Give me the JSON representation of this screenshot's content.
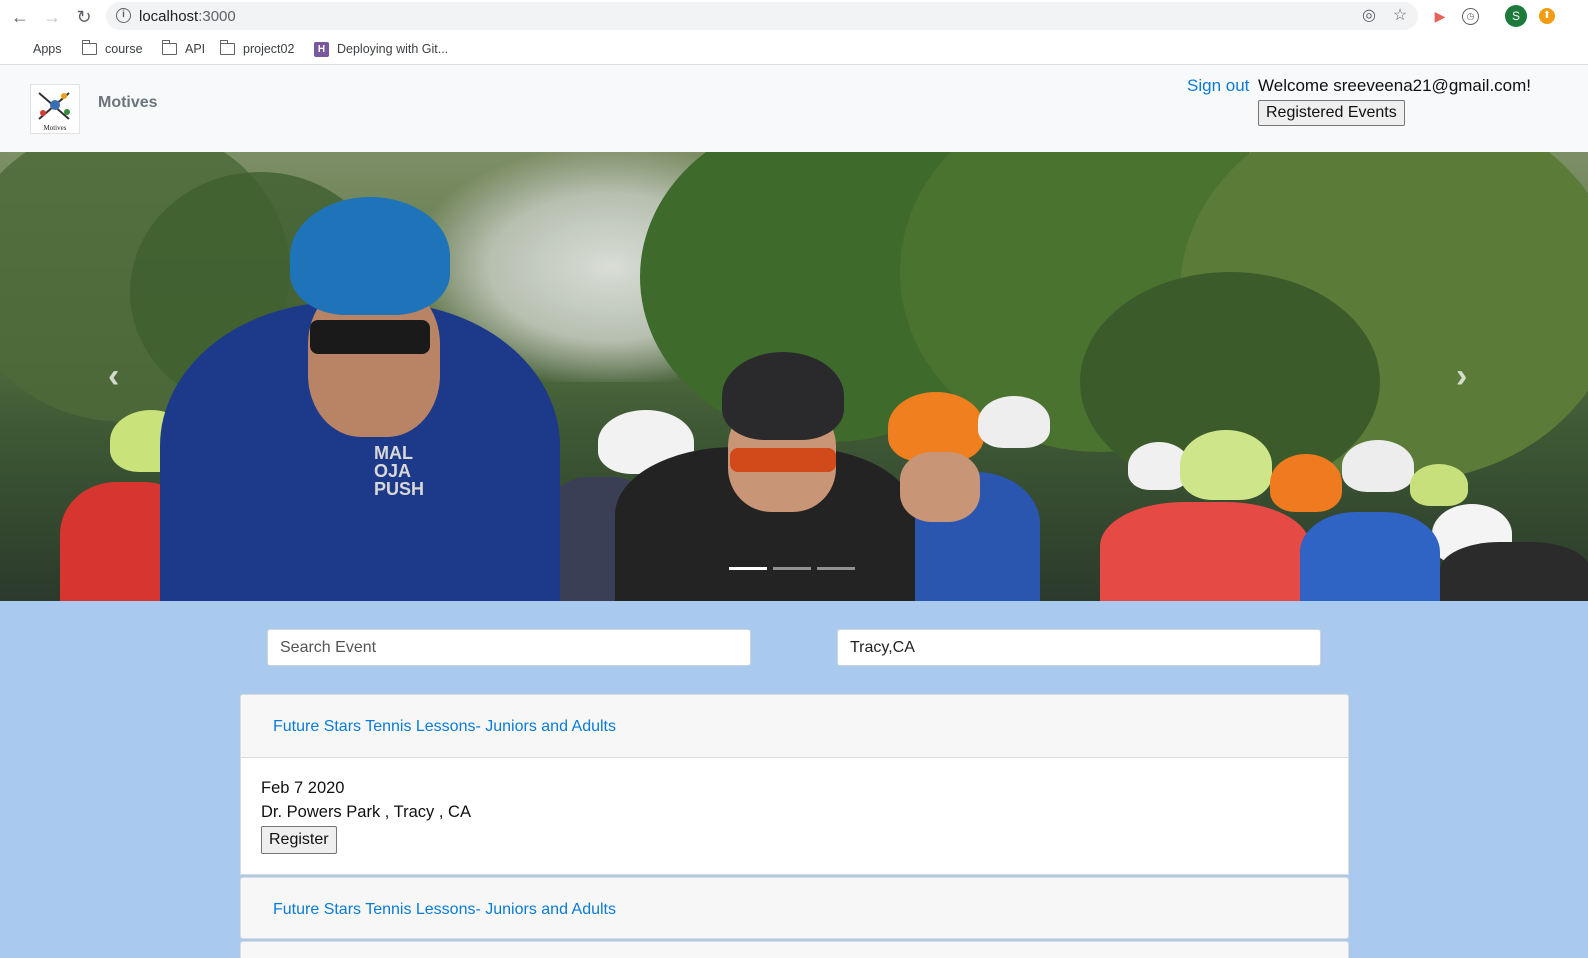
{
  "browser": {
    "url_host": "localhost",
    "url_port": ":3000",
    "profile_initial": "S",
    "bookmarks": [
      {
        "label": "Apps",
        "icon": "apps-grid-icon"
      },
      {
        "label": "course",
        "icon": "folder-icon"
      },
      {
        "label": "API",
        "icon": "folder-icon"
      },
      {
        "label": "project02",
        "icon": "folder-icon"
      },
      {
        "label": "Deploying with Git...",
        "icon": "heroku-icon"
      }
    ]
  },
  "navbar": {
    "brand": "Motives",
    "logo_text": "Motives",
    "sign_out": "Sign out",
    "welcome": "Welcome sreeveena21@gmail.com!",
    "registered_events": "Registered Events"
  },
  "carousel": {
    "jersey_text": "MAL OJA PUSH",
    "prev": "‹",
    "next": "›",
    "indicator_count": 3,
    "active_indicator": 0
  },
  "search": {
    "event_placeholder": "Search Event",
    "event_value": "",
    "location_value": "Tracy,CA"
  },
  "events": [
    {
      "title": "Future Stars Tennis Lessons- Juniors and Adults",
      "date": "Feb 7 2020",
      "location": "Dr. Powers Park , Tracy , CA",
      "register_label": "Register"
    },
    {
      "title": "Future Stars Tennis Lessons- Juniors and Adults"
    }
  ],
  "colors": {
    "link": "#0a7bd9",
    "content_bg": "#a9c9ef",
    "navbar_bg": "#f8f9fa"
  }
}
